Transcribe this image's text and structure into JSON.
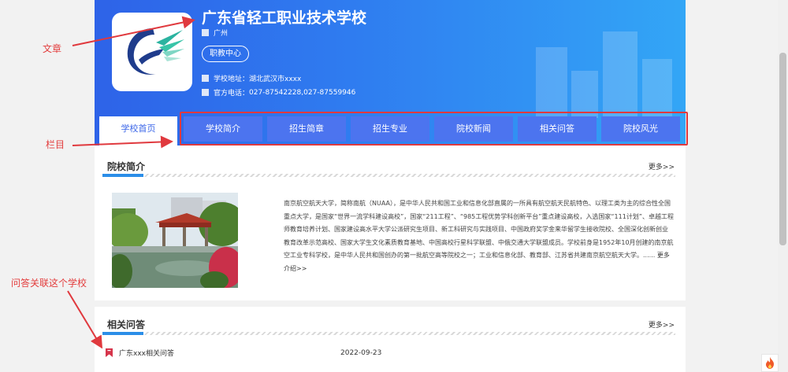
{
  "school": {
    "name": "广东省轻工职业技术学校",
    "region": "广州",
    "tag": "职教中心",
    "address_label": "学校地址：",
    "address": "湖北武汉市xxxx",
    "phone_label": "官方电话：",
    "phone": "027-87542228,027-87559946"
  },
  "nav": {
    "home": "学校首页",
    "tabs": [
      "学校简介",
      "招生简章",
      "招生专业",
      "院校新闻",
      "相关问答",
      "院校风光"
    ]
  },
  "intro_section": {
    "title": "院校简介",
    "more": "更多>>",
    "text": "南京航空航天大学，简称南航（NUAA），是中华人民共和国工业和信息化部直属的一所具有航空航天民航特色、以理工类为主的综合性全国重点大学，是国家“世界一流学科建设高校”，国家“211工程”、“985工程优势学科创新平台”重点建设高校，入选国家“111计划”、卓越工程师教育培养计划、国家建设高水平大学公派研究生项目、新工科研究与实践项目、中国政府奖学金来华留学生接收院校、全国深化创新创业教育改革示范高校、国家大学生文化素质教育基地、中国高校行星科学联盟、中俄交通大学联盟成员。学校前身是1952年10月创建的南京航空工业专科学校，是中华人民共和国创办的第一批航空高等院校之一；工业和信息化部、教育部、江苏省共建南京航空航天大学。......",
    "more_intro": "更多介绍>>"
  },
  "qa_section": {
    "title": "相关问答",
    "more": "更多>>",
    "items": [
      {
        "title": "广东xxx相关问答",
        "date": "2022-09-23"
      }
    ]
  },
  "annotations": {
    "article": "文章",
    "column": "栏目",
    "qa_relation": "问答关联这个学校"
  },
  "colors": {
    "banner_start": "#2e63e8",
    "banner_end": "#33a6f6",
    "tab_bg": "#4c74ef",
    "accent": "#2b8ee8",
    "annotation_red": "#e0393e"
  },
  "icons": [
    "school-logo-icon",
    "bookmark-icon",
    "fire-icon"
  ]
}
